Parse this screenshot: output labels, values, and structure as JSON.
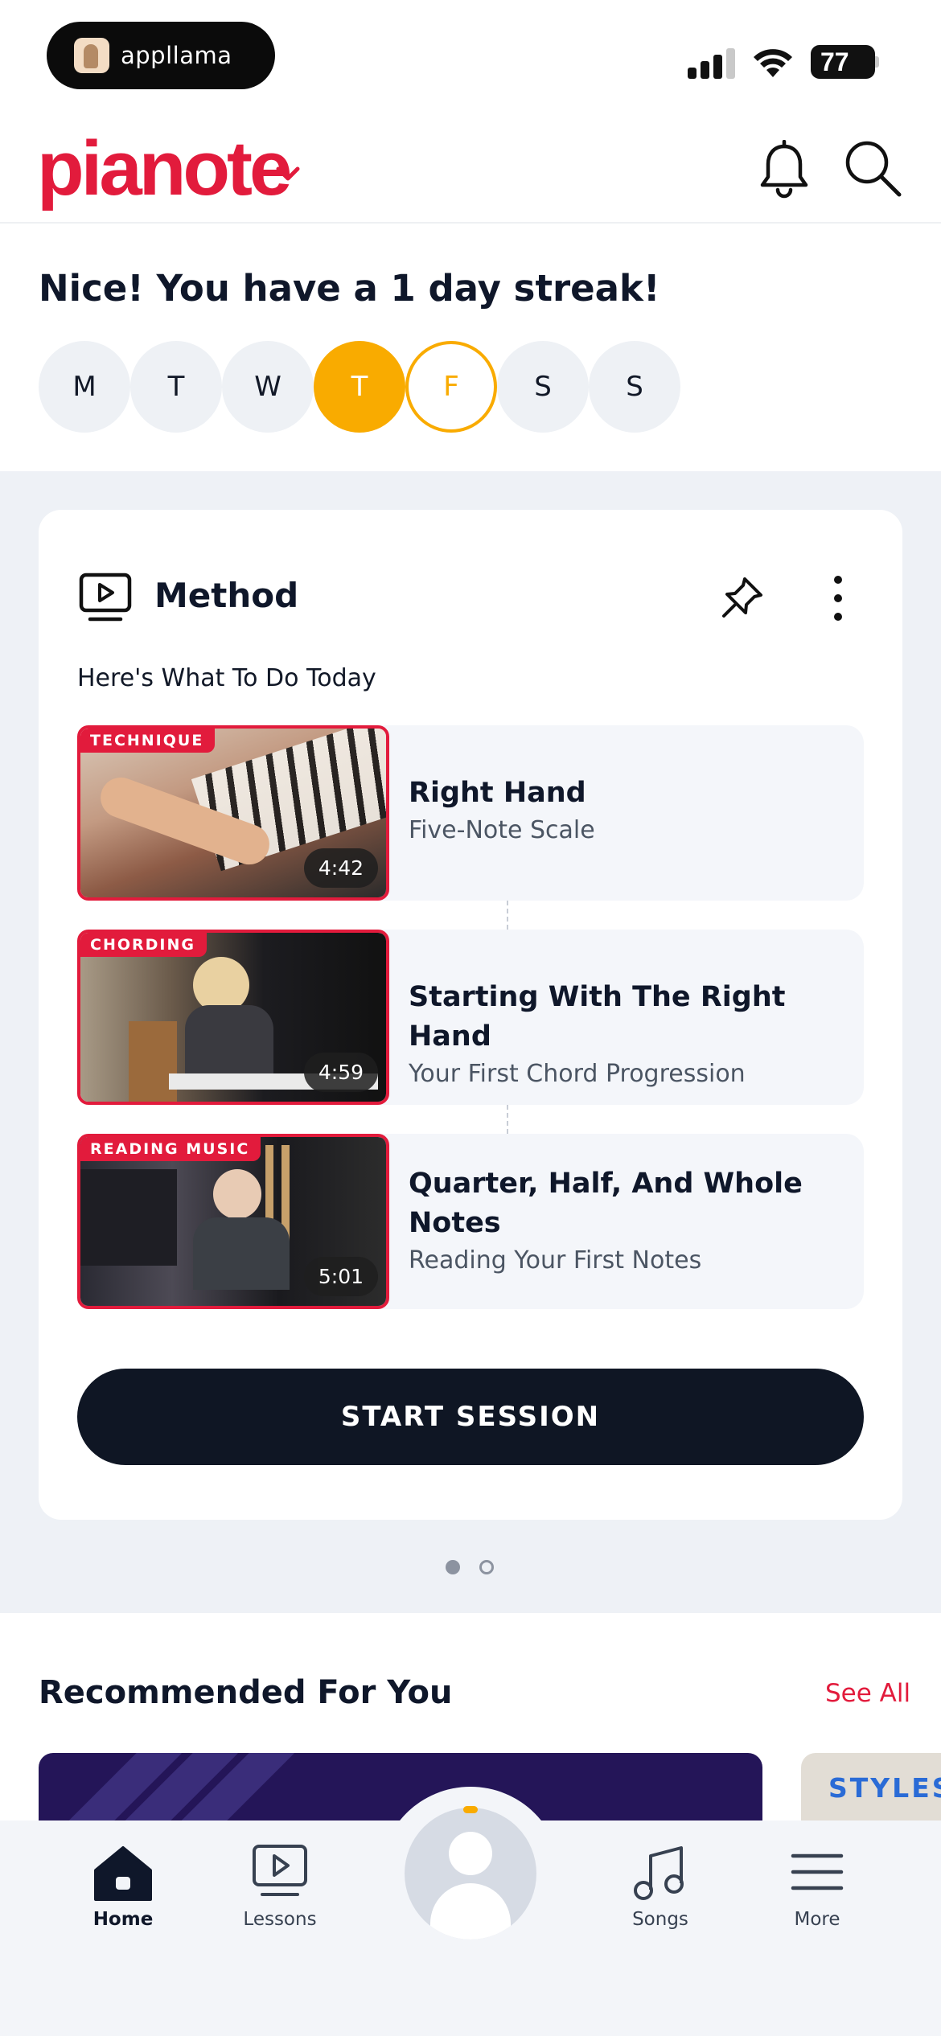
{
  "status_bar": {
    "app_pill_label": "appllama",
    "battery": "77"
  },
  "header": {
    "logo": "pianote"
  },
  "streak": {
    "title": "Nice! You have a 1 day streak!",
    "days": [
      "M",
      "T",
      "W",
      "T",
      "F",
      "S",
      "S"
    ],
    "completed_index": 3,
    "today_index": 4
  },
  "method": {
    "title": "Method",
    "subtitle": "Here's What To Do Today",
    "lessons": [
      {
        "tag": "TECHNIQUE",
        "duration": "4:42",
        "title": "Right Hand",
        "subtitle": "Five-Note Scale"
      },
      {
        "tag": "CHORDING",
        "duration": "4:59",
        "title": "Starting With The Right Hand",
        "subtitle": "Your First Chord Progression"
      },
      {
        "tag": "READING MUSIC",
        "duration": "5:01",
        "title": "Quarter, Half, And Whole Notes",
        "subtitle": "Reading Your First Notes"
      }
    ],
    "start_button": "START SESSION",
    "pagination": {
      "current": 1,
      "total": 2
    }
  },
  "recommended": {
    "title": "Recommended For You",
    "see_all": "See All",
    "peek_card_label": "STYLES"
  },
  "bottom_nav": {
    "items": [
      {
        "label": "Home",
        "icon": "home-icon",
        "active": true
      },
      {
        "label": "Lessons",
        "icon": "play-screen-icon",
        "active": false
      },
      {
        "label": "Songs",
        "icon": "music-note-icon",
        "active": false
      },
      {
        "label": "More",
        "icon": "hamburger-menu-icon",
        "active": false
      }
    ],
    "profile_icon": "avatar-icon"
  },
  "colors": {
    "brand": "#e21b3c",
    "streak": "#f9ab00",
    "dark": "#0f1624",
    "link": "#2a6bd6"
  }
}
